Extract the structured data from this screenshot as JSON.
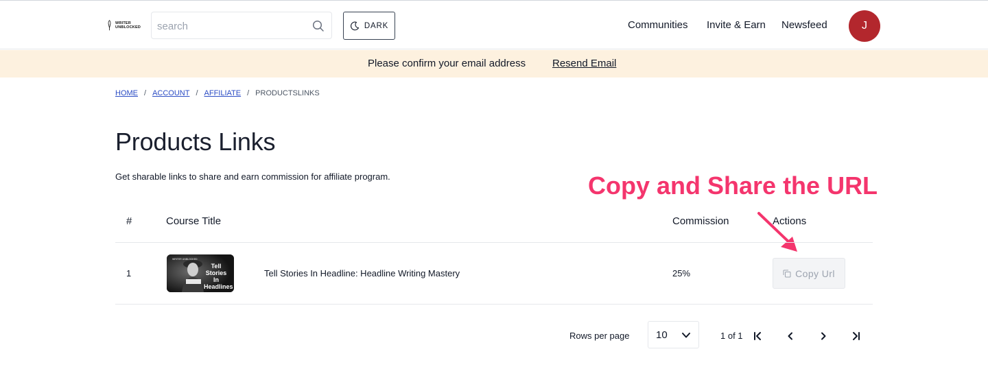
{
  "header": {
    "logo_line1": "WRITER",
    "logo_line2": "UNBLOCKED",
    "search_placeholder": "search",
    "theme_toggle_label": "DARK",
    "nav": [
      "Communities",
      "Invite & Earn",
      "Newsfeed"
    ],
    "avatar_initial": "J",
    "avatar_color": "#b3272d"
  },
  "banner": {
    "message": "Please confirm your email address",
    "action": "Resend Email",
    "background": "#fdf1df"
  },
  "breadcrumb": {
    "items": [
      "HOME",
      "ACCOUNT",
      "AFFILIATE"
    ],
    "separator": "/",
    "current": "PRODUCTSLINKS"
  },
  "page": {
    "title": "Products Links",
    "subtitle": "Get sharable links to share and earn commission for affiliate program."
  },
  "annotation": {
    "text": "Copy and Share the URL",
    "color": "#f4356d"
  },
  "table": {
    "columns": [
      "#",
      "Course Title",
      "Commission",
      "Actions"
    ],
    "rows": [
      {
        "index": "1",
        "thumbnail_text": "Tell Stories In Headlines",
        "thumbnail_brand": "WRITER UNBLOCKED",
        "title": "Tell Stories In Headline: Headline Writing Mastery",
        "commission": "25%",
        "action_label": "Copy Url"
      }
    ]
  },
  "pagination": {
    "rows_label": "Rows per page",
    "rows_value": "10",
    "page_info": "1 of 1"
  }
}
